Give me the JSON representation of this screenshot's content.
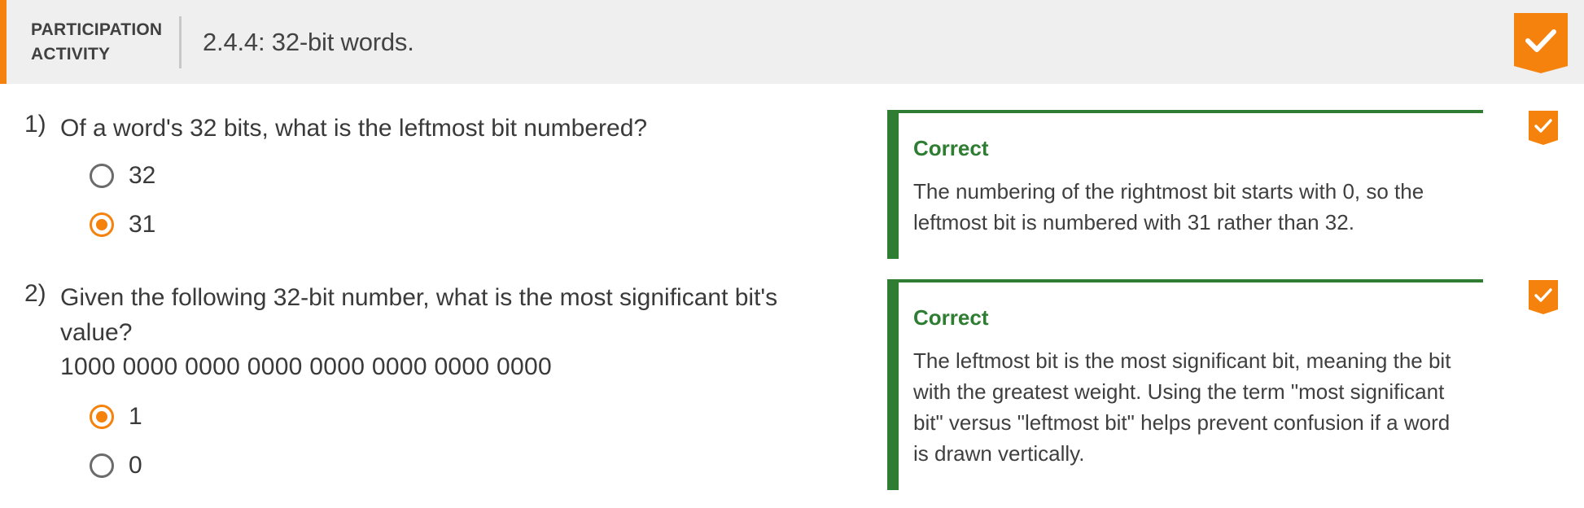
{
  "header": {
    "label": "PARTICIPATION ACTIVITY",
    "title": "2.4.4: 32-bit words.",
    "status_icon": "check-icon"
  },
  "colors": {
    "accent": "#f5820d",
    "correct": "#2e7d32",
    "header_bg": "#efefef"
  },
  "questions": [
    {
      "number": "1)",
      "text": "Of a word's 32 bits, what is the leftmost bit numbered?",
      "data": "",
      "options": [
        {
          "label": "32",
          "selected": false
        },
        {
          "label": "31",
          "selected": true
        }
      ],
      "feedback": {
        "title": "Correct",
        "text": "The numbering of the rightmost bit starts with 0, so the leftmost bit is numbered with 31 rather than 32."
      },
      "status_icon": "check-icon"
    },
    {
      "number": "2)",
      "text": "Given the following 32-bit number, what is the most significant bit's value?",
      "data": "1000 0000 0000 0000 0000 0000 0000 0000",
      "options": [
        {
          "label": "1",
          "selected": true
        },
        {
          "label": "0",
          "selected": false
        }
      ],
      "feedback": {
        "title": "Correct",
        "text": "The leftmost bit is the most significant bit, meaning the bit with the greatest weight. Using the term \"most significant bit\" versus \"leftmost bit\" helps prevent confusion if a word is drawn vertically."
      },
      "status_icon": "check-icon"
    }
  ]
}
